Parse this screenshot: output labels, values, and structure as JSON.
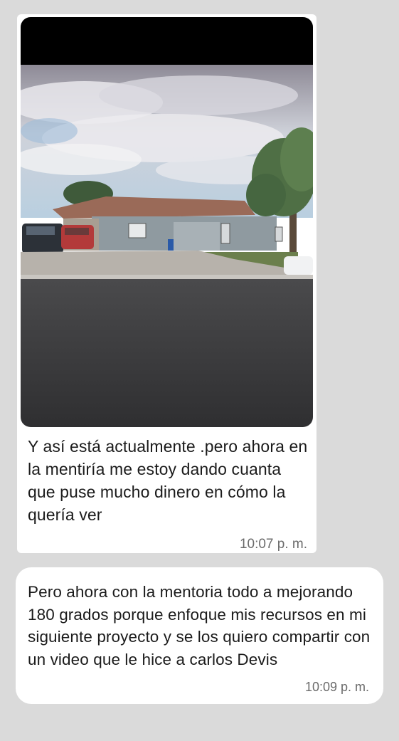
{
  "messages": [
    {
      "text": "Y así está actualmente .pero ahora en la mentiría me estoy dando cuanta que puse mucho dinero en cómo la quería ver",
      "time": "10:07 p. m."
    },
    {
      "text": "Pero ahora con la mentoria todo a mejorando 180 grados porque enfoque mis recursos en mi siguiente proyecto y se los quiero compartir con un video que le hice a carlos Devis",
      "time": "10:09 p. m."
    }
  ],
  "colors": {
    "background": "#dadada",
    "bubble": "#ffffff",
    "text": "#1b1b1b",
    "timestamp": "#6b6b6b"
  }
}
